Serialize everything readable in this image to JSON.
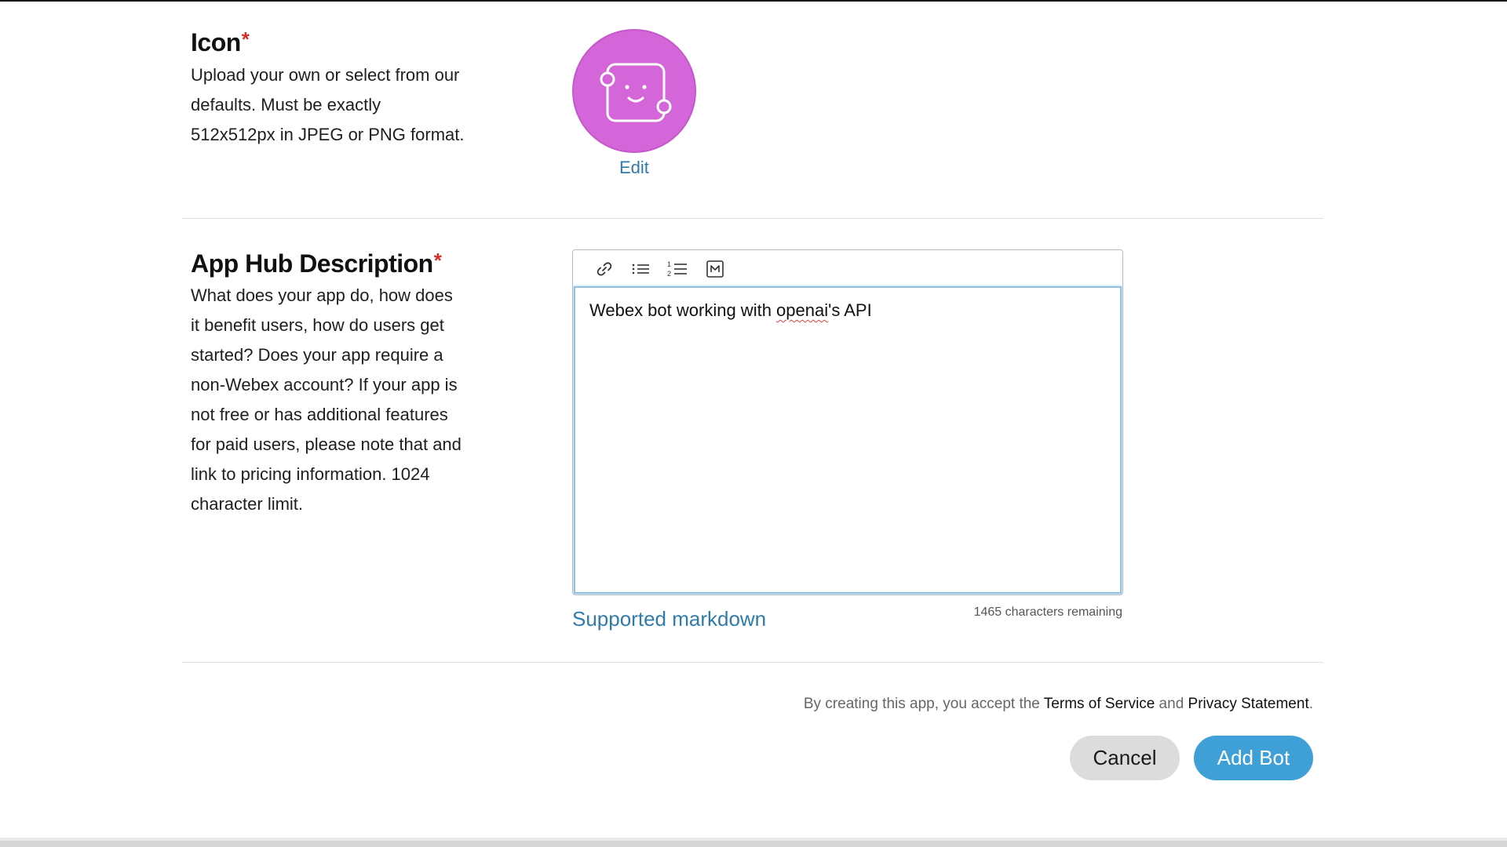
{
  "icon_section": {
    "title": "Icon",
    "required_mark": "*",
    "description": "Upload your own or select from our defaults. Must be exactly 512x512px in JPEG or PNG format.",
    "avatar_icon": "bot-face-icon",
    "avatar_color": "#d466d9",
    "edit_label": "Edit"
  },
  "description_section": {
    "title": "App Hub Description",
    "required_mark": "*",
    "description": "What does your app do, how does it benefit users, how do users get started? Does your app require a non-Webex account? If your app is not free or has additional features for paid users, please note that and link to pricing information. 1024 character limit.",
    "toolbar": [
      {
        "icon": "link-icon"
      },
      {
        "icon": "bulleted-list-icon"
      },
      {
        "icon": "numbered-list-icon"
      },
      {
        "icon": "markdown-icon"
      }
    ],
    "text_before": "Webex bot working with ",
    "text_misspelled": "openai",
    "text_after": "'s API",
    "markdown_link": "Supported markdown",
    "chars_remaining": "1465 characters remaining"
  },
  "footer": {
    "terms_prefix": "By creating this app, you accept the ",
    "terms_link": "Terms of Service",
    "terms_and": " and ",
    "privacy_link": "Privacy Statement",
    "terms_suffix": ".",
    "cancel_label": "Cancel",
    "add_label": "Add Bot"
  },
  "colors": {
    "link": "#2f7bab",
    "primary_button": "#3fa0d8",
    "required": "#d4302b"
  }
}
